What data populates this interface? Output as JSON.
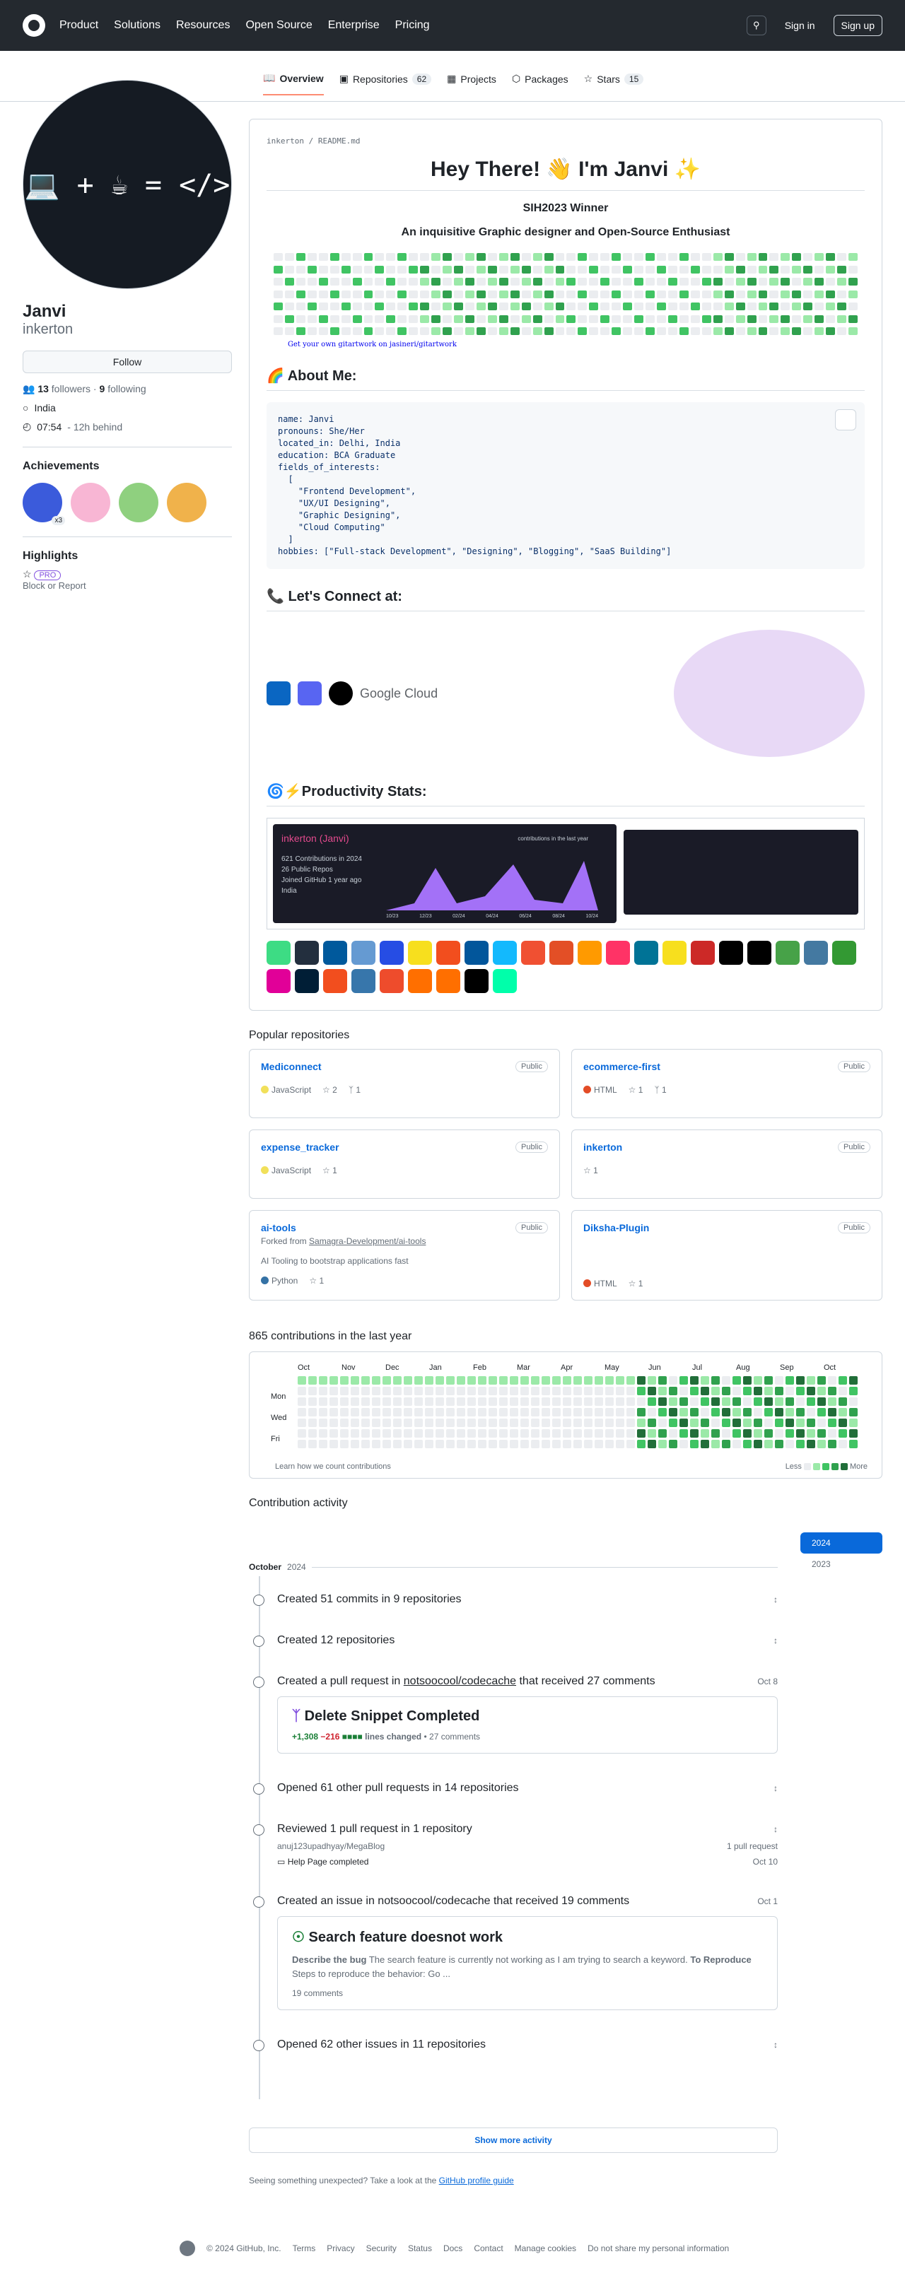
{
  "nav": {
    "items": [
      "Product",
      "Solutions",
      "Resources",
      "Open Source",
      "Enterprise",
      "Pricing"
    ],
    "signin": "Sign in",
    "signup": "Sign up"
  },
  "tabs": [
    {
      "label": "Overview"
    },
    {
      "label": "Repositories",
      "count": "62"
    },
    {
      "label": "Projects"
    },
    {
      "label": "Packages"
    },
    {
      "label": "Stars",
      "count": "15"
    }
  ],
  "profile": {
    "avatar_text": "💻 + ☕ = </>",
    "name": "Janvi",
    "login": "inkerton",
    "follow": "Follow",
    "followers": "13",
    "followers_label": "followers",
    "following": "9",
    "following_label": "following",
    "location": "India",
    "time": "07:54",
    "time_note": "- 12h behind"
  },
  "achievements": {
    "title": "Achievements",
    "x3": "x3"
  },
  "highlights": {
    "title": "Highlights",
    "pro": "PRO",
    "block": "Block or Report"
  },
  "readme": {
    "path": "inkerton",
    "file": "README.md",
    "heading": "Hey There! 👋 I'm Janvi ✨",
    "sub1": "SIH2023 Winner",
    "sub2": "An inquisitive Graphic designer and Open-Source Enthusiast",
    "getyour": "Get your own gitartwork on jasineri/gitartwork",
    "about": "🌈 About Me:",
    "code": "name: Janvi\npronouns: She/Her\nlocated_in: Delhi, India\neducation: BCA Graduate\nfields_of_interests:\n  [\n    \"Frontend Development\",\n    \"UX/UI Designing\",\n    \"Graphic Designing\",\n    \"Cloud Computing\"\n  ]\nhobbies: [\"Full-stack Development\", \"Designing\", \"Blogging\", \"SaaS Building\"]",
    "connect": "📞 Let's Connect at:",
    "google_cloud": "Google Cloud",
    "stats": "🌀⚡Productivity Stats:",
    "card_title": "inkerton (Janvi)",
    "card_sub": "contributions in the last year",
    "card_lines": [
      "621 Contributions in 2024",
      "26 Public Repos",
      "Joined GitHub 1 year ago",
      "India"
    ],
    "card_months": [
      "10/23",
      "12/23",
      "02/24",
      "04/24",
      "06/24",
      "08/24",
      "10/24"
    ]
  },
  "popular": {
    "title": "Popular repositories",
    "repos": [
      {
        "name": "Mediconnect",
        "vis": "Public",
        "lang": "JavaScript",
        "color": "#f1e05a",
        "stars": "2",
        "forks": "1"
      },
      {
        "name": "ecommerce-first",
        "vis": "Public",
        "lang": "HTML",
        "color": "#e34c26",
        "stars": "1",
        "forks": "1"
      },
      {
        "name": "expense_tracker",
        "vis": "Public",
        "lang": "JavaScript",
        "color": "#f1e05a",
        "stars": "1"
      },
      {
        "name": "inkerton",
        "vis": "Public",
        "stars": "1"
      },
      {
        "name": "ai-tools",
        "vis": "Public",
        "fork": "Forked from",
        "fork_src": "Samagra-Development/ai-tools",
        "desc": "AI Tooling to bootstrap applications fast",
        "lang": "Python",
        "color": "#3572a5",
        "stars": "1"
      },
      {
        "name": "Diksha-Plugin",
        "vis": "Public",
        "lang": "HTML",
        "color": "#e34c26",
        "stars": "1"
      }
    ]
  },
  "contrib": {
    "title": "865 contributions in the last year",
    "months": [
      "Oct",
      "Nov",
      "Dec",
      "Jan",
      "Feb",
      "Mar",
      "Apr",
      "May",
      "Jun",
      "Jul",
      "Aug",
      "Sep",
      "Oct"
    ],
    "days": [
      "Mon",
      "Wed",
      "Fri"
    ],
    "learn": "Learn how we count contributions",
    "less": "Less",
    "more": "More"
  },
  "activity": {
    "title": "Contribution activity",
    "month": "October",
    "year": "2024",
    "years": [
      "2024",
      "2023"
    ],
    "created_commits": "Created 51 commits in 9 repositories",
    "created_repos": "Created 12 repositories",
    "pr_created_pre": "Created a pull request in",
    "pr_repo": "notsoocool/codecache",
    "pr_created_post": "that received 27 comments",
    "pr_date": "Oct 8",
    "pr_title": "Delete Snippet Completed",
    "pr_add": "+1,308",
    "pr_del": "−216",
    "pr_lines": "lines changed",
    "pr_comments": "• 27 comments",
    "opened_prs": "Opened 61 other pull requests in 14 repositories",
    "reviewed": "Reviewed 1 pull request in 1 repository",
    "rev_repo": "anuj123upadhyay/MegaBlog",
    "rev_count": "1 pull request",
    "rev_item": "Help Page completed",
    "rev_date": "Oct 10",
    "issue_created": "Created an issue in notsoocool/codecache that received 19 comments",
    "issue_date": "Oct 1",
    "issue_title": "Search feature doesnot work",
    "issue_b1": "Describe the bug",
    "issue_t1": "The search feature is currently not working as I am trying to search a keyword.",
    "issue_b2": "To Reproduce",
    "issue_t2": "Steps to reproduce the behavior: Go ...",
    "issue_comments": "19 comments",
    "opened_issues": "Opened 62 other issues in 11 repositories",
    "show_more": "Show more activity"
  },
  "unexpected": "Seeing something unexpected? Take a look at the",
  "guide": "GitHub profile guide",
  "footer": {
    "copy": "© 2024 GitHub, Inc.",
    "links": [
      "Terms",
      "Privacy",
      "Security",
      "Status",
      "Docs",
      "Contact",
      "Manage cookies",
      "Do not share my personal information"
    ]
  }
}
